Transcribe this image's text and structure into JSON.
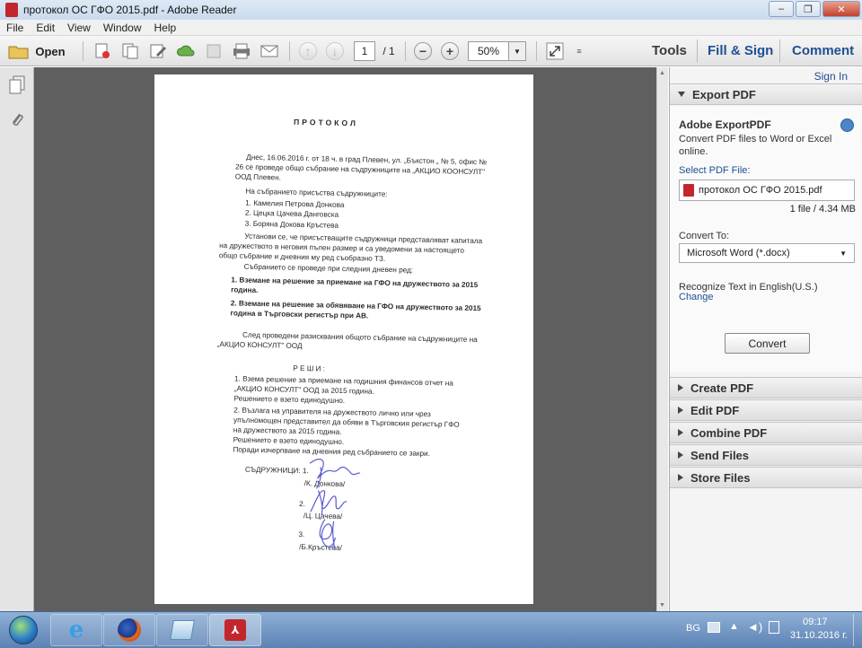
{
  "window": {
    "title": "протокол  ОС  ГФО  2015.pdf - Adobe Reader",
    "min": "–",
    "max": "❐",
    "close": "✕"
  },
  "menu": [
    "File",
    "Edit",
    "View",
    "Window",
    "Help"
  ],
  "toolbar": {
    "open_label": "Open",
    "page_current": "1",
    "page_total": "/ 1",
    "zoom": "50%",
    "tools": "Tools",
    "fill_sign": "Fill & Sign",
    "comment": "Comment"
  },
  "document": {
    "title": "ПРОТОКОЛ",
    "lines": [
      "Днес, 16.06.2016 г. от 18 ч. в град Плевен, ул. „Бъкстон „ № 5, офис №",
      "26 се проведе общо събрание на съдружниците на „АКЦИО КООНСУЛТ\"",
      "ООД Плевен.",
      "На събранието присъства съдружниците:",
      "1.  Камелия Петрова Донкова",
      "2.  Цецка Цачева Данговска",
      "3.  Боряна Докова Кръстева",
      "Установи се, че присъстващите съдружници представляват капитала",
      "на дружеството в неговия пълен размер и са  уведомени  за настоящето",
      "общо събрание и дневния му ред съобразно ТЗ.",
      "Събранието се проведе при следния дневен ред:",
      "1.  Вземане на решение  за приемане на ГФО на дружеството за 2015",
      "     година.",
      "2.  Вземане на решение за обявяване на ГФО на дружеството за 2015",
      "     година в Търговски регистър при АВ.",
      "След проведени разисквания общото събрание на съдружниците на",
      "„АКЦИО КОНСУЛТ\" ООД",
      "Р Е Ш И :",
      "1.  Взема решение за приемане на годишния финансов отчет на",
      "     „АКЦИО КОНСУЛТ\" ООД за 2015 година.",
      "     Решението е взето единодушно.",
      "2.  Възлага на управителя на дружеството лично или чрез",
      "     упълномощен представител да  обяви в Търговския регистър  ГФО",
      "     на дружеството за 2015 година.",
      "     Решението е взето единодушно.",
      "     Поради изчерпване на дневния ред събранието се закри.",
      "СЪДРУЖНИЦИ: 1.",
      "/К. Донкова/",
      "2.",
      "/Ц. Цачева/",
      "3.",
      "/Б.Кръстева/"
    ]
  },
  "panel": {
    "sign_in": "Sign In",
    "export_pdf": "Export PDF",
    "adobe_exportpdf": "Adobe ExportPDF",
    "description_line1": "Convert PDF files to Word or Excel",
    "description_line2": "online.",
    "select_label": "Select PDF File:",
    "file_name": "протокол  ОС  ГФО  2015.pdf",
    "file_info": "1 file / 4.34 MB",
    "convert_to_label": "Convert To:",
    "convert_to_value": "Microsoft Word (*.docx)",
    "recognize": "Recognize Text in English(U.S.)",
    "change": "Change",
    "convert_button": "Convert",
    "sections": [
      "Create PDF",
      "Edit PDF",
      "Combine PDF",
      "Send Files",
      "Store Files"
    ]
  },
  "taskbar": {
    "lang": "BG",
    "time": "09:17",
    "date": "31.10.2016 г."
  }
}
